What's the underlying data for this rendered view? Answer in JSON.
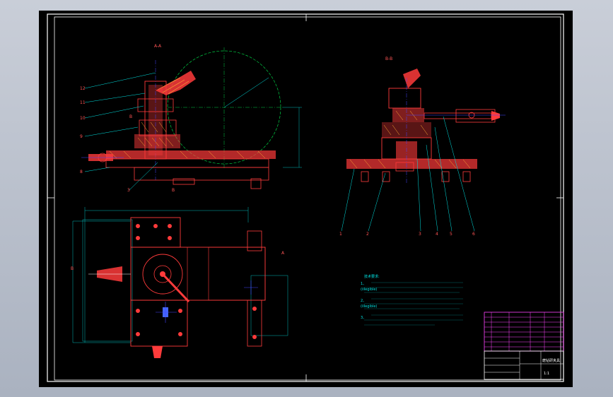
{
  "colors": {
    "background": "#000000",
    "frame": "#ffffff",
    "part": "#ff3b3b",
    "hatch": "#ffaa33",
    "leader": "#00e5e5",
    "center": "#00cc44",
    "axis": "#4444ff",
    "title_block": "#ff44ff"
  },
  "views": {
    "section_a": {
      "label": "A-A"
    },
    "section_b": {
      "label": "B-B"
    },
    "marker_a": "A",
    "marker_b": "B",
    "marker_b2": "B"
  },
  "callouts_left": [
    "12",
    "11",
    "10",
    "9",
    "8",
    "3"
  ],
  "callouts_right": [
    "1",
    "2",
    "3",
    "4",
    "5",
    "6"
  ],
  "notes": {
    "heading": "技术要求:",
    "lines": [
      "1、",
      "     (illegible)",
      "2、",
      "     (illegible)",
      "3、"
    ]
  },
  "title_block": {
    "name": "磨钻研夹具",
    "scale": "1:1"
  }
}
